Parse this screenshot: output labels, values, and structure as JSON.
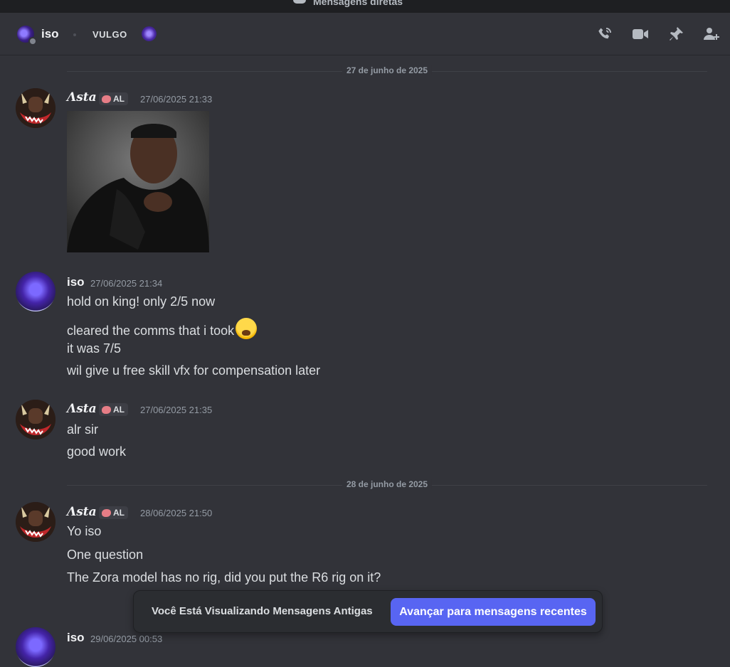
{
  "titlebar": {
    "title": "Mensagens diretas"
  },
  "header": {
    "name": "iso",
    "tag": "VULGO",
    "icons": [
      "phone-call-icon",
      "video-camera-icon",
      "pin-icon",
      "add-friend-icon"
    ]
  },
  "dividers": [
    "27 de junho de 2025",
    "28 de junho de 2025"
  ],
  "messages": [
    {
      "user": "Λsta",
      "tag": "AL",
      "time": "27/06/2025 21:33",
      "lines": []
    },
    {
      "user": "iso",
      "time": "27/06/2025 21:34",
      "lines": [
        "hold on king! only 2/5 now",
        "cleared the comms that i took",
        "it was 7/5",
        "wil give u free skill vfx for compensation later"
      ]
    },
    {
      "user": "Λsta",
      "tag": "AL",
      "time": "27/06/2025 21:35",
      "lines": [
        "alr sir",
        "good work"
      ]
    },
    {
      "user": "Λsta",
      "tag": "AL",
      "time": "28/06/2025 21:50",
      "lines": [
        "Yo iso",
        "One question",
        "The Zora model has no rig, did you put the R6 rig on it?"
      ]
    },
    {
      "user": "iso",
      "time": "29/06/2025 00:53",
      "lines": []
    }
  ],
  "banner": {
    "text": "Você Está Visualizando Mensagens Antigas",
    "button": "Avançar para mensagens recentes"
  },
  "colors": {
    "accent": "#5865f2",
    "background": "#323339"
  }
}
